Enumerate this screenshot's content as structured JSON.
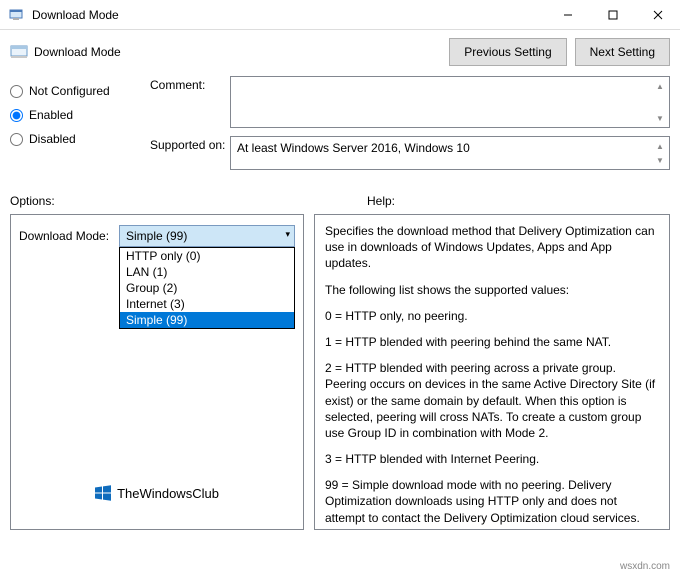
{
  "window": {
    "title": "Download Mode"
  },
  "page": {
    "title": "Download Mode"
  },
  "nav": {
    "prev": "Previous Setting",
    "next": "Next Setting"
  },
  "state": {
    "not_configured": "Not Configured",
    "enabled": "Enabled",
    "disabled": "Disabled",
    "selected": "enabled"
  },
  "fields": {
    "comment_label": "Comment:",
    "comment_value": "",
    "supported_label": "Supported on:",
    "supported_value": "At least Windows Server 2016, Windows 10"
  },
  "sections": {
    "options_label": "Options:",
    "help_label": "Help:"
  },
  "options": {
    "download_mode_label": "Download Mode:",
    "selected_value": "Simple (99)",
    "items": [
      "HTTP only (0)",
      "LAN (1)",
      "Group (2)",
      "Internet (3)",
      "Simple (99)"
    ],
    "highlighted_index": 4
  },
  "branding": {
    "text": "TheWindowsClub"
  },
  "help": {
    "p1": "Specifies the download method that Delivery Optimization can use in downloads of Windows Updates, Apps and App updates.",
    "p2": "The following list shows the supported values:",
    "p3": "0 = HTTP only, no peering.",
    "p4": "1 = HTTP blended with peering behind the same NAT.",
    "p5": "2 = HTTP blended with peering across a private group. Peering occurs on devices in the same Active Directory Site (if exist) or the same domain by default. When this option is selected, peering will cross NATs. To create a custom group use Group ID in combination with Mode 2.",
    "p6": "3 = HTTP blended with Internet Peering.",
    "p7": "99 = Simple download mode with no peering. Delivery Optimization downloads using HTTP only and does not attempt to contact the Delivery Optimization cloud services."
  },
  "watermark": "wsxdn.com"
}
